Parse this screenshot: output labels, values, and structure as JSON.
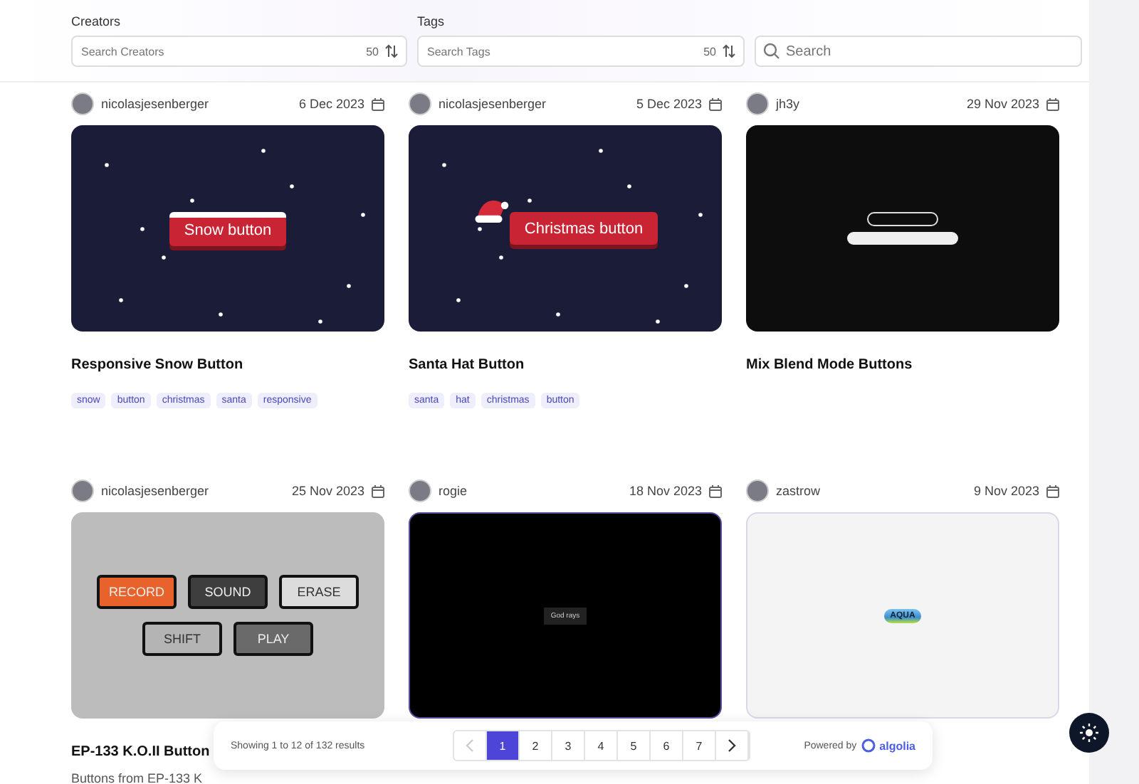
{
  "filters": {
    "creators": {
      "label": "Creators",
      "placeholder": "Search Creators",
      "count": "50"
    },
    "tags": {
      "label": "Tags",
      "placeholder": "Search Tags",
      "count": "50"
    },
    "search": {
      "placeholder": "Search"
    }
  },
  "cards": [
    {
      "author": "nicolasjesenberger",
      "date": "6 Dec 2023",
      "preview": {
        "kind": "snow",
        "label": "Snow button"
      },
      "title": "Responsive Snow Button",
      "tags": [
        "snow",
        "button",
        "christmas",
        "santa",
        "responsive"
      ]
    },
    {
      "author": "nicolasjesenberger",
      "date": "5 Dec 2023",
      "preview": {
        "kind": "santa",
        "label": "Christmas button"
      },
      "title": "Santa Hat Button",
      "tags": [
        "santa",
        "hat",
        "christmas",
        "button"
      ]
    },
    {
      "author": "jh3y",
      "date": "29 Nov 2023",
      "preview": {
        "kind": "blend"
      },
      "title": "Mix Blend Mode Buttons"
    },
    {
      "author": "nicolasjesenberger",
      "date": "25 Nov 2023",
      "preview": {
        "kind": "keys",
        "keys": [
          {
            "label": "RECORD",
            "color": "#e8632c"
          },
          {
            "label": "SOUND",
            "color": "#3e3e3e"
          },
          {
            "label": "ERASE",
            "color": "#dcdcdc"
          },
          {
            "label": "SHIFT",
            "color": "#b4b4b4"
          },
          {
            "label": "PLAY",
            "color": "#6a6a6a"
          }
        ]
      },
      "title": "EP-133 K.O.II Button",
      "description": "Buttons from EP-133 K"
    },
    {
      "author": "rogie",
      "date": "18 Nov 2023",
      "preview": {
        "kind": "godrays",
        "label": "God rays"
      }
    },
    {
      "author": "zastrow",
      "date": "9 Nov 2023",
      "preview": {
        "kind": "aqua",
        "label": "AQUA"
      }
    }
  ],
  "pagination": {
    "summary": "Showing 1 to 12 of 132 results",
    "prev_disabled": true,
    "pages": [
      {
        "label": "1",
        "selected": true
      },
      {
        "label": "2",
        "selected": false
      },
      {
        "label": "3",
        "selected": false
      },
      {
        "label": "4",
        "selected": false
      },
      {
        "label": "5",
        "selected": false
      },
      {
        "label": "6",
        "selected": false
      },
      {
        "label": "7",
        "selected": false
      }
    ],
    "powered_by": "Powered by",
    "brand": "algolia"
  }
}
